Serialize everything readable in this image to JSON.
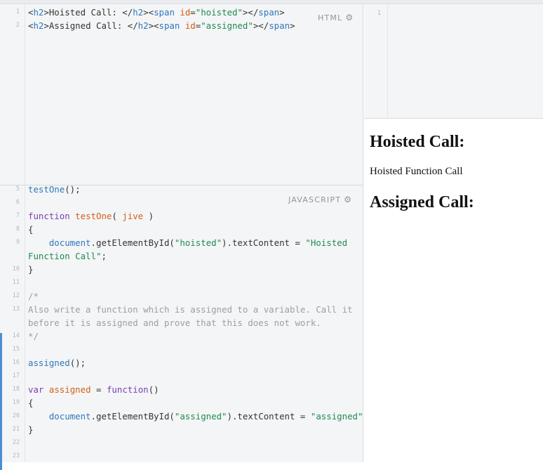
{
  "editors": {
    "html": {
      "label": "HTML",
      "lines": [
        {
          "n": "1",
          "tokens": [
            {
              "t": "<",
              "c": ""
            },
            {
              "t": "h2",
              "c": "t-tag"
            },
            {
              "t": ">Hoisted Call: </",
              "c": ""
            },
            {
              "t": "h2",
              "c": "t-tag"
            },
            {
              "t": "><",
              "c": ""
            },
            {
              "t": "span",
              "c": "t-tag"
            },
            {
              "t": " ",
              "c": ""
            },
            {
              "t": "id",
              "c": "t-attr"
            },
            {
              "t": "=",
              "c": ""
            },
            {
              "t": "\"hoisted\"",
              "c": "t-str"
            },
            {
              "t": "></",
              "c": ""
            },
            {
              "t": "span",
              "c": "t-tag"
            },
            {
              "t": ">",
              "c": ""
            }
          ]
        },
        {
          "n": "2",
          "tokens": [
            {
              "t": "<",
              "c": ""
            },
            {
              "t": "h2",
              "c": "t-tag"
            },
            {
              "t": ">Assigned Call: </",
              "c": ""
            },
            {
              "t": "h2",
              "c": "t-tag"
            },
            {
              "t": "><",
              "c": ""
            },
            {
              "t": "span",
              "c": "t-tag"
            },
            {
              "t": " ",
              "c": ""
            },
            {
              "t": "id",
              "c": "t-attr"
            },
            {
              "t": "=",
              "c": ""
            },
            {
              "t": "\"assigned\"",
              "c": "t-str"
            },
            {
              "t": "></",
              "c": ""
            },
            {
              "t": "span",
              "c": "t-tag"
            },
            {
              "t": ">",
              "c": ""
            }
          ]
        }
      ]
    },
    "javascript": {
      "label": "JAVASCRIPT",
      "lines": [
        {
          "n": "5",
          "tokens": [
            {
              "t": "testOne",
              "c": "t-obj"
            },
            {
              "t": "();",
              "c": ""
            }
          ]
        },
        {
          "n": "6",
          "tokens": []
        },
        {
          "n": "7",
          "tokens": [
            {
              "t": "function",
              "c": "t-kw"
            },
            {
              "t": " ",
              "c": ""
            },
            {
              "t": "testOne",
              "c": "t-fn"
            },
            {
              "t": "( ",
              "c": ""
            },
            {
              "t": "jive",
              "c": "t-fn"
            },
            {
              "t": " )",
              "c": ""
            }
          ]
        },
        {
          "n": "8",
          "tokens": [
            {
              "t": "{",
              "c": ""
            }
          ]
        },
        {
          "n": "9",
          "tokens": [
            {
              "t": "    ",
              "c": ""
            },
            {
              "t": "document",
              "c": "t-obj"
            },
            {
              "t": ".getElementById(",
              "c": ""
            },
            {
              "t": "\"hoisted\"",
              "c": "t-str"
            },
            {
              "t": ").textContent = ",
              "c": ""
            },
            {
              "t": "\"Hoisted",
              "c": "t-str"
            }
          ]
        },
        {
          "n": "",
          "tokens": [
            {
              "t": "Function Call\"",
              "c": "t-str"
            },
            {
              "t": ";",
              "c": ""
            }
          ]
        },
        {
          "n": "10",
          "tokens": [
            {
              "t": "}",
              "c": ""
            }
          ]
        },
        {
          "n": "11",
          "tokens": []
        },
        {
          "n": "12",
          "tokens": [
            {
              "t": "/*",
              "c": "t-com"
            }
          ]
        },
        {
          "n": "13",
          "tokens": [
            {
              "t": "Also write a function which is assigned to a variable. Call it",
              "c": "t-com"
            }
          ]
        },
        {
          "n": "",
          "tokens": [
            {
              "t": "before it is assigned and prove that this does not work.",
              "c": "t-com"
            }
          ]
        },
        {
          "n": "14",
          "tokens": [
            {
              "t": "*/",
              "c": "t-com"
            }
          ]
        },
        {
          "n": "15",
          "tokens": []
        },
        {
          "n": "16",
          "tokens": [
            {
              "t": "assigned",
              "c": "t-obj"
            },
            {
              "t": "();",
              "c": ""
            }
          ]
        },
        {
          "n": "17",
          "tokens": []
        },
        {
          "n": "18",
          "tokens": [
            {
              "t": "var",
              "c": "t-kw"
            },
            {
              "t": " ",
              "c": ""
            },
            {
              "t": "assigned",
              "c": "t-fn"
            },
            {
              "t": " = ",
              "c": ""
            },
            {
              "t": "function",
              "c": "t-kw"
            },
            {
              "t": "()",
              "c": ""
            }
          ]
        },
        {
          "n": "19",
          "tokens": [
            {
              "t": "{",
              "c": ""
            }
          ]
        },
        {
          "n": "20",
          "tokens": [
            {
              "t": "    ",
              "c": ""
            },
            {
              "t": "document",
              "c": "t-obj"
            },
            {
              "t": ".getElementById(",
              "c": ""
            },
            {
              "t": "\"assigned\"",
              "c": "t-str"
            },
            {
              "t": ").textContent = ",
              "c": ""
            },
            {
              "t": "\"assigned\"",
              "c": "t-str"
            },
            {
              "t": ";",
              "c": ""
            }
          ]
        },
        {
          "n": "21",
          "tokens": [
            {
              "t": "}",
              "c": ""
            }
          ]
        },
        {
          "n": "22",
          "tokens": []
        },
        {
          "n": "23",
          "tokens": []
        }
      ]
    },
    "css": {
      "lines": [
        {
          "n": "1",
          "tokens": []
        }
      ]
    }
  },
  "preview": {
    "hoisted_heading": "Hoisted Call:",
    "hoisted_value": "Hoisted Function Call",
    "assigned_heading": "Assigned Call:"
  },
  "colors": {
    "tag": "#2f77bd",
    "attribute": "#d35f15",
    "string": "#1e8a52",
    "keyword": "#7b3fb0",
    "comment": "#9aa0a6",
    "active_indicator": "#4a8fd6"
  }
}
